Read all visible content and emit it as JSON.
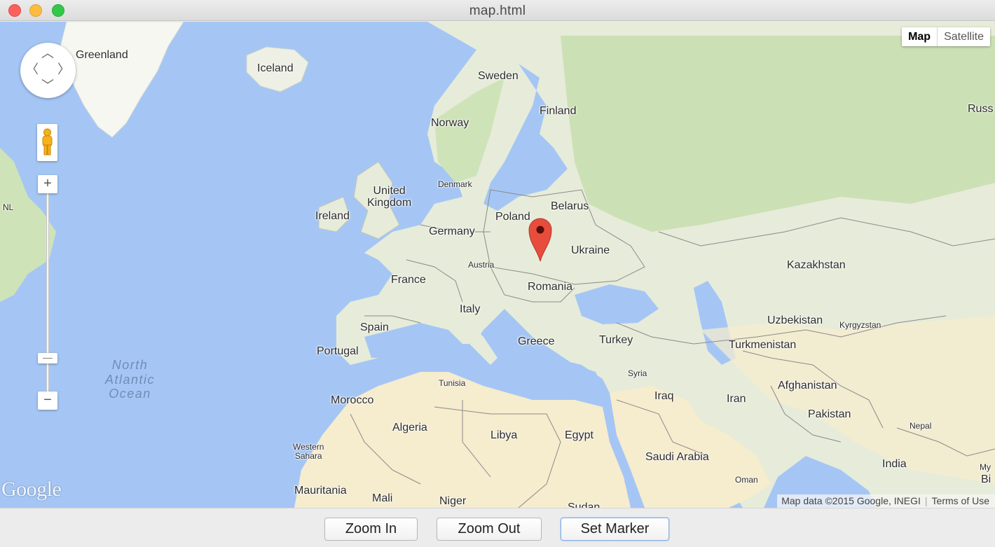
{
  "window": {
    "title": "map.html"
  },
  "map": {
    "type_buttons": {
      "map": "Map",
      "satellite": "Satellite"
    },
    "selected_type": "Map",
    "zoom_in_symbol": "+",
    "zoom_out_symbol": "−",
    "ocean_label": "North\nAtlantic\nOcean",
    "logo": "Google",
    "attribution": "Map data ©2015 Google, INEGI",
    "terms": "Terms of Use",
    "countries": {
      "greenland": "Greenland",
      "iceland": "Iceland",
      "sweden": "Sweden",
      "finland": "Finland",
      "norway": "Norway",
      "russia": "Russ",
      "uk": "United\nKingdom",
      "denmark": "Denmark",
      "ireland": "Ireland",
      "poland": "Poland",
      "belarus": "Belarus",
      "germany": "Germany",
      "nl": "NL",
      "ukraine": "Ukraine",
      "austria": "Austria",
      "france": "France",
      "romania": "Romania",
      "kazakhstan": "Kazakhstan",
      "italy": "Italy",
      "spain": "Spain",
      "uzbekistan": "Uzbekistan",
      "kyrgyzstan": "Kyrgyzstan",
      "portugal": "Portugal",
      "greece": "Greece",
      "turkey": "Turkey",
      "turkmenistan": "Turkmenistan",
      "syria": "Syria",
      "tunisia": "Tunisia",
      "afghanistan": "Afghanistan",
      "morocco": "Morocco",
      "iraq": "Iraq",
      "iran": "Iran",
      "pakistan": "Pakistan",
      "algeria": "Algeria",
      "libya": "Libya",
      "egypt": "Egypt",
      "nepal": "Nepal",
      "western_sahara": "Western\nSahara",
      "saudi_arabia": "Saudi Arabia",
      "india": "India",
      "oman": "Oman",
      "mauritania": "Mauritania",
      "mali": "Mali",
      "niger": "Niger",
      "sudan": "Sudan",
      "bi": "Bi",
      "my": "My"
    }
  },
  "toolbar": {
    "zoom_in": "Zoom In",
    "zoom_out": "Zoom Out",
    "set_marker": "Set Marker"
  },
  "colors": {
    "water": "#a5c6f5",
    "land": "#e6ecd9",
    "forest": "#c9dfb0",
    "desert": "#f6ecce",
    "marker": "#e74c3c"
  }
}
